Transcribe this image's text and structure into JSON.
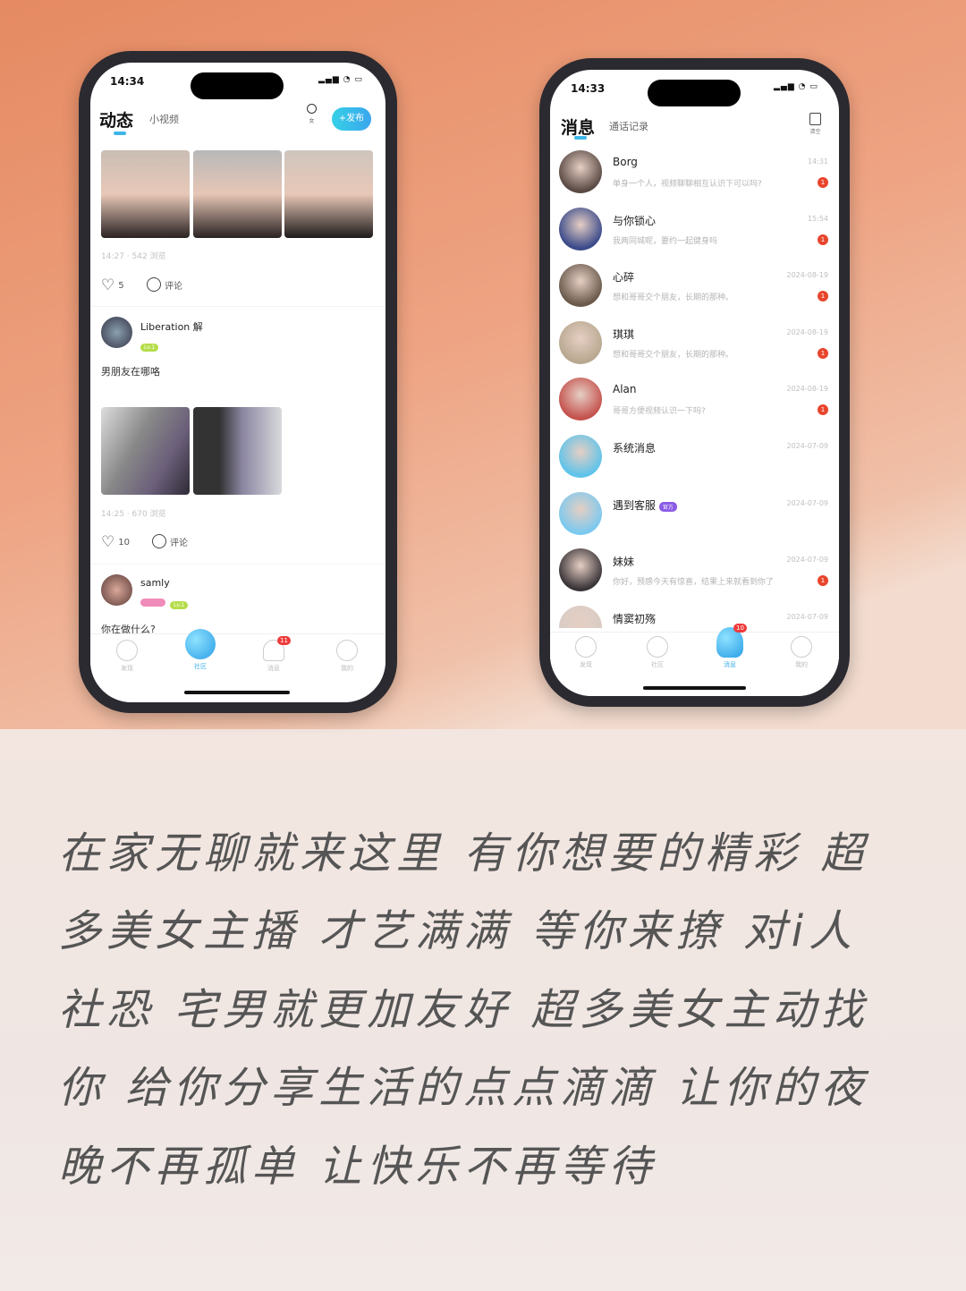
{
  "left_phone": {
    "status_time": "14:34",
    "tabs": [
      {
        "label": "动态"
      },
      {
        "label": "小视频"
      }
    ],
    "gender_filter": "女",
    "publish_button": "+发布",
    "posts": [
      {
        "meta": "14:27 · 542 浏览",
        "likes": "5",
        "comment_label": "评论"
      },
      {
        "author": "Liberation 解",
        "level": "Lv.1",
        "text": "男朋友在哪咯",
        "meta": "14:25 · 670 浏览",
        "likes": "10",
        "comment_label": "评论"
      },
      {
        "author": "samly",
        "level": "Lv.1",
        "text": "你在做什么?"
      }
    ],
    "tabbar": [
      {
        "label": "发现"
      },
      {
        "label": "社区"
      },
      {
        "label": "消息",
        "badge": "11"
      },
      {
        "label": "我的"
      }
    ]
  },
  "right_phone": {
    "status_time": "14:33",
    "tabs": [
      {
        "label": "消息"
      },
      {
        "label": "通话记录"
      }
    ],
    "clear_label": "清空",
    "conversations": [
      {
        "name": "Borg",
        "preview": "单身一个人，视频聊聊相互认识下可以吗?",
        "date": "14:31",
        "unread": "1",
        "color": "#5a4a44"
      },
      {
        "name": "与你锁心",
        "preview": "我两同城呢，要约一起健身吗",
        "date": "15:54",
        "unread": "1",
        "color": "#3b4a8a"
      },
      {
        "name": "心碎",
        "preview": "想和哥哥交个朋友，长期的那种。",
        "date": "2024-08-19",
        "unread": "1",
        "color": "#6a5a4c"
      },
      {
        "name": "琪琪",
        "preview": "想和哥哥交个朋友，长期的那种。",
        "date": "2024-08-19",
        "unread": "1",
        "color": "#b9a890"
      },
      {
        "name": "Alan",
        "preview": "哥哥方便视频认识一下吗?",
        "date": "2024-08-19",
        "unread": "1",
        "color": "#c4524e"
      },
      {
        "name": "系统消息",
        "preview": "",
        "date": "2024-07-09",
        "unread": "",
        "color": "#5fc3ea"
      },
      {
        "name": "遇到客服",
        "tag": "官方",
        "preview": "",
        "date": "2024-07-09",
        "unread": "",
        "color": "#7cc9ef"
      },
      {
        "name": "妹妹",
        "preview": "你好，预感今天有惊喜，结果上来就看到你了",
        "date": "2024-07-09",
        "unread": "1",
        "color": "#3a3438"
      },
      {
        "name": "情窦初殇",
        "preview": "",
        "date": "2024-07-09",
        "unread": "",
        "color": "#d8ccc4"
      }
    ],
    "tabbar": [
      {
        "label": "发现"
      },
      {
        "label": "社区"
      },
      {
        "label": "消息",
        "badge": "10"
      },
      {
        "label": "我的"
      }
    ]
  },
  "slogan_lines": [
    "在家无聊就来这里 有你想要的精彩 超",
    "多美女主播 才艺满满 等你来撩 对i人",
    "社恐 宅男就更加友好 超多美女主动找",
    "你 给你分享生活的点点滴滴 让你的夜",
    "晚不再孤单 让快乐不再等待"
  ]
}
